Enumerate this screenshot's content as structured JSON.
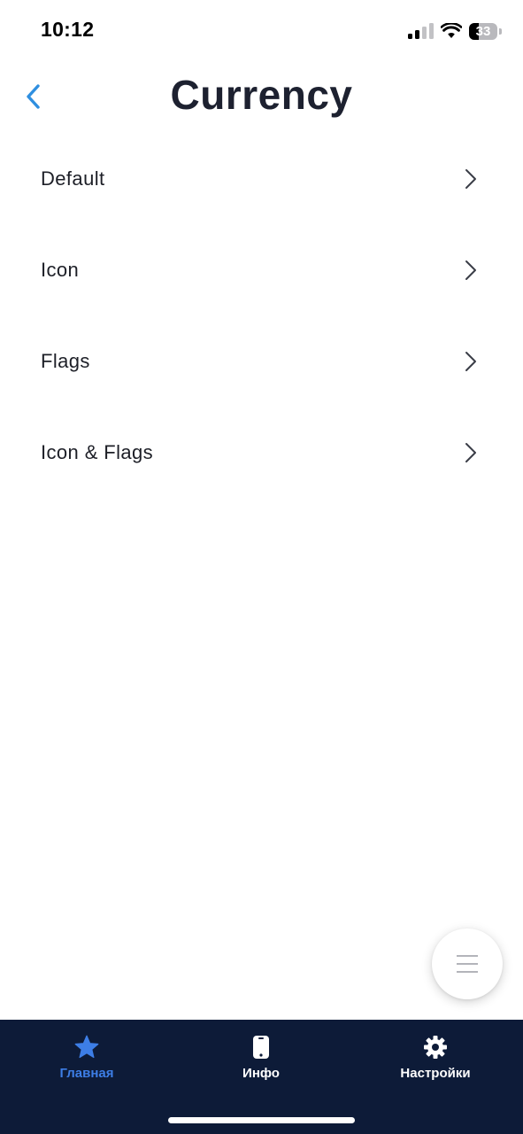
{
  "status_bar": {
    "time": "10:12",
    "battery_level": "33",
    "battery_fraction": 0.33,
    "icons": [
      "cellular-signal-icon",
      "wifi-icon",
      "battery-icon"
    ]
  },
  "header": {
    "title": "Currency",
    "back_icon": "chevron-left-icon"
  },
  "menu": {
    "items": [
      {
        "label": "Default"
      },
      {
        "label": "Icon"
      },
      {
        "label": "Flags"
      },
      {
        "label": "Icon & Flags"
      }
    ]
  },
  "fab": {
    "icon": "menu-lines-icon"
  },
  "tab_bar": {
    "tabs": [
      {
        "label": "Главная",
        "icon": "star-icon",
        "active": true
      },
      {
        "label": "Инфо",
        "icon": "phone-icon",
        "active": false
      },
      {
        "label": "Настройки",
        "icon": "gear-icon",
        "active": false
      }
    ]
  },
  "colors": {
    "accent": "#3d7ee6",
    "back_arrow": "#2f8fe0",
    "tab_bar_background": "#0d1b38",
    "title_text": "#1d2130"
  }
}
